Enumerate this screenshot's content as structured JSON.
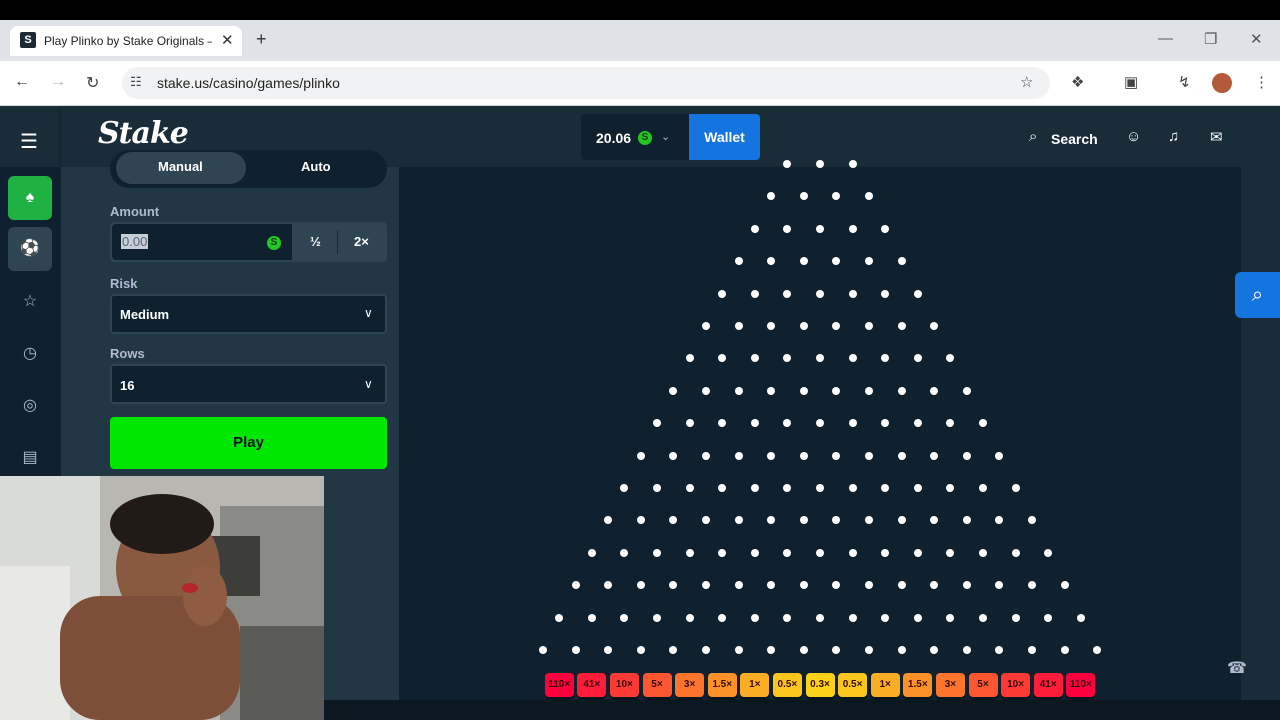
{
  "browser": {
    "tab_title": "Play Plinko by Stake Originals – ",
    "tab_favicon": "S",
    "tab_close": "✕",
    "new_tab": "+",
    "url": "stake.us/casino/games/plinko",
    "window_controls": [
      "—",
      "❐",
      "✕"
    ],
    "nav_icons": {
      "back": "←",
      "forward": "→",
      "reload": "↻"
    },
    "toolbar_icons": [
      "bookmark-star-icon",
      "extensions-icon",
      "cast-icon",
      "performance-icon",
      "profile-avatar",
      "menu-dots-icon"
    ]
  },
  "header": {
    "logo": "Stake",
    "balance": "20.06",
    "currency_symbol": "S",
    "wallet_label": "Wallet",
    "search_label": "Search"
  },
  "leftnav": {
    "items": [
      {
        "name": "casino",
        "glyph": "♠"
      },
      {
        "name": "sports",
        "glyph": "⚽"
      },
      {
        "name": "favourites",
        "glyph": "☆"
      },
      {
        "name": "recent",
        "glyph": "◷"
      },
      {
        "name": "challenges",
        "glyph": "◎"
      },
      {
        "name": "my-bets",
        "glyph": "▤"
      }
    ]
  },
  "controls": {
    "mode_manual": "Manual",
    "mode_auto": "Auto",
    "amount_label": "Amount",
    "amount_value": "0.00",
    "half_label": "½",
    "double_label": "2×",
    "risk_label": "Risk",
    "risk_value": "Medium",
    "rows_label": "Rows",
    "rows_value": "16",
    "play_label": "Play"
  },
  "board": {
    "rows": 16,
    "multipliers": [
      "110×",
      "41×",
      "10×",
      "5×",
      "3×",
      "1.5×",
      "1×",
      "0.5×",
      "0.3×",
      "0.5×",
      "1×",
      "1.5×",
      "3×",
      "5×",
      "10×",
      "41×",
      "110×"
    ],
    "bucket_colors": [
      "#ff003f",
      "#ff1d3a",
      "#fe3a36",
      "#fd5731",
      "#fd742c",
      "#fc9128",
      "#fbad23",
      "#fbc61e",
      "#fbd219",
      "#fbc61e",
      "#fbad23",
      "#fc9128",
      "#fd742c",
      "#fd5731",
      "#fe3a36",
      "#ff1d3a",
      "#ff003f"
    ]
  },
  "colors": {
    "accent_green": "#00e701",
    "wallet_blue": "#1475e1",
    "bg_dark": "#0f212e",
    "bg_panel": "#213743"
  }
}
